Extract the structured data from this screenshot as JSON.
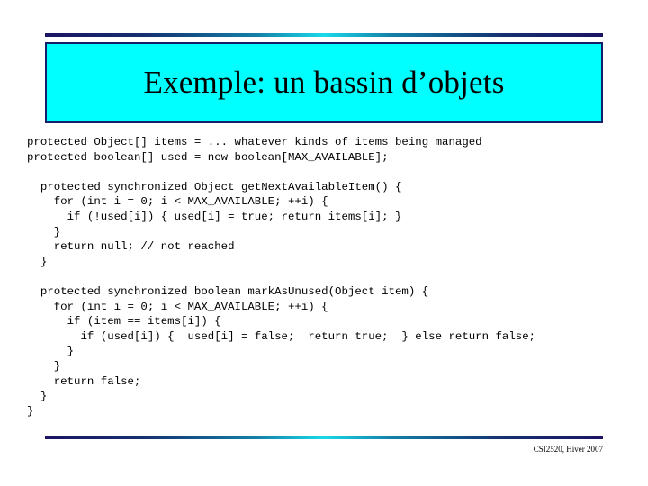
{
  "slide": {
    "title": "Exemple: un bassin d’objets",
    "footer": "CSI2520, Hiver 2007",
    "colors": {
      "title_box_fill": "#00ffff",
      "title_box_border": "#13216b",
      "rule_dark": "#1b1464",
      "rule_light": "#1ad9e8",
      "background": "#ffffff",
      "text": "#000000"
    }
  },
  "code": {
    "lines": [
      "protected Object[] items = ... whatever kinds of items being managed",
      "protected boolean[] used = new boolean[MAX_AVAILABLE];",
      "",
      "  protected synchronized Object getNextAvailableItem() {",
      "    for (int i = 0; i < MAX_AVAILABLE; ++i) {",
      "      if (!used[i]) { used[i] = true; return items[i]; }",
      "    }",
      "    return null; // not reached",
      "  }",
      "",
      "  protected synchronized boolean markAsUnused(Object item) {",
      "    for (int i = 0; i < MAX_AVAILABLE; ++i) {",
      "      if (item == items[i]) {",
      "        if (used[i]) {  used[i] = false;  return true;  } else return false;",
      "      }",
      "    }",
      "    return false;",
      "  }",
      "}"
    ]
  }
}
